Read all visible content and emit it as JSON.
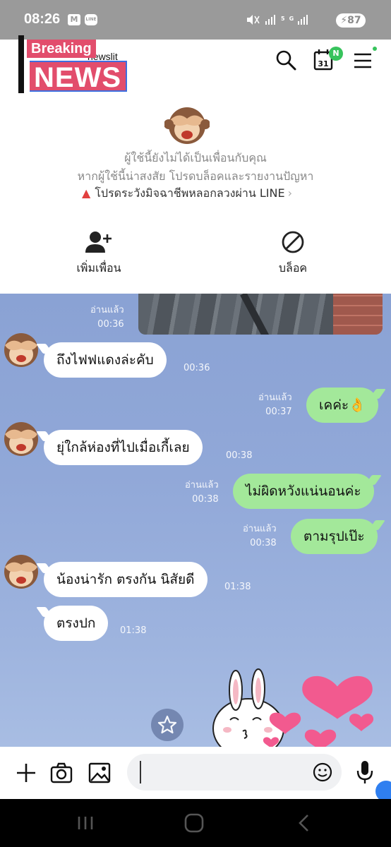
{
  "status_bar": {
    "time": "08:26",
    "gmail_icon": "M",
    "line_icon": "LINE",
    "signal_text": "5G",
    "battery": "87"
  },
  "header": {
    "logo_top": "Breaking",
    "logo_bottom": "NEWS",
    "logo_behind": "newslit",
    "calendar_day": "31",
    "calendar_badge": "N"
  },
  "notice": {
    "line1": "ผู้ใช้นี้ยังไม่ได้เป็นเพื่อนกับคุณ",
    "line2": "หากผู้ใช้นี้น่าสงสัย โปรดบล็อคและรายงานปัญหา",
    "scam_warning": "โปรดระวังมิจฉาชีพหลอกลวงผ่าน LINE",
    "add_friend": "เพิ่มเพื่อน",
    "block": "บล็อค"
  },
  "messages": [
    {
      "side": "out",
      "type": "photo",
      "read": "อ่านแล้ว",
      "time": "00:36"
    },
    {
      "side": "in",
      "text": "ถึงไฟฟแดงล่ะคับ",
      "time": "00:36"
    },
    {
      "side": "out",
      "text": "เคค่ะ👌",
      "read": "อ่านแล้ว",
      "time": "00:37"
    },
    {
      "side": "in",
      "text": "ยุ่ใกล้ห่องที่ไปเมื่อเกี้เลย",
      "time": "00:38"
    },
    {
      "side": "out",
      "text": "ไม่ผิดหวังแน่นอนค่ะ",
      "read": "อ่านแล้ว",
      "time": "00:38"
    },
    {
      "side": "out",
      "text": "ตามรุปเป๊ะ",
      "read": "อ่านแล้ว",
      "time": "00:38"
    },
    {
      "side": "in",
      "text": "น้องน่ารัก ตรงกัน นิสัยดี",
      "time": "01:38"
    },
    {
      "side": "in",
      "text": "ตรงปก",
      "time": "01:38"
    }
  ],
  "input": {
    "placeholder": "",
    "value": ""
  },
  "colors": {
    "chat_bg": "#8aa2d4",
    "out_bubble": "#a3e89a",
    "badge_green": "#37c35c",
    "warning_red": "#e2403f"
  }
}
